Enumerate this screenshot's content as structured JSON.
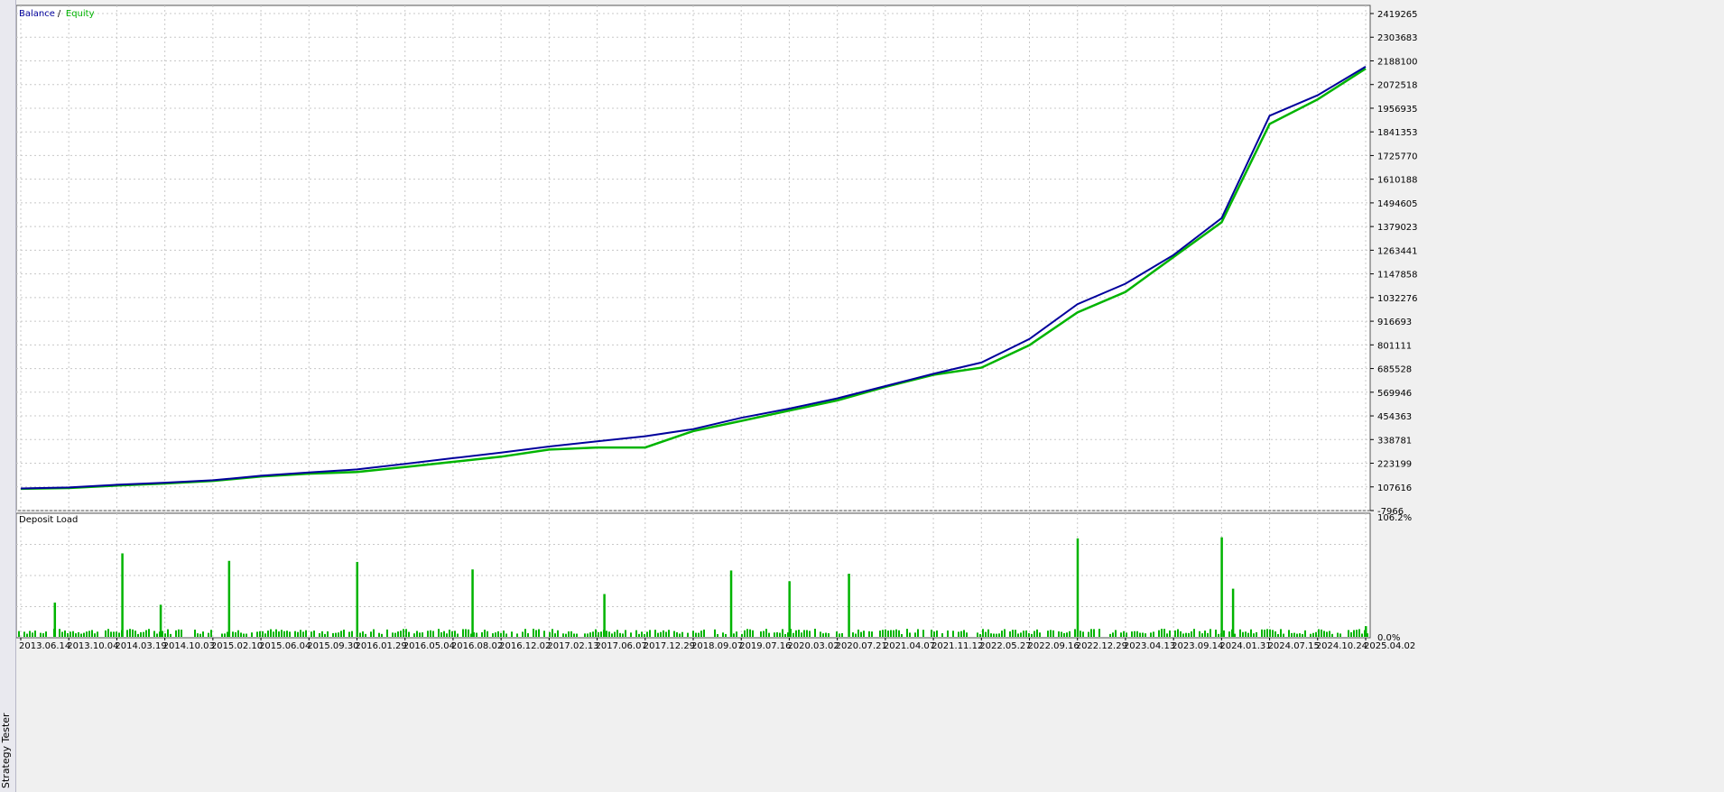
{
  "window": {
    "side_label": "Strategy Tester"
  },
  "colors": {
    "balance": "#00009c",
    "equity": "#00b400",
    "deposit_load": "#00b400",
    "grid": "#c8c8c8",
    "background": "#ffffff"
  },
  "chart_data": [
    {
      "type": "line",
      "legend": [
        "Balance",
        "Equity"
      ],
      "legend_separator": "/",
      "legend_placement": "top-left",
      "grid": true,
      "ylim": [
        -7966,
        2419265
      ],
      "y_ticks": [
        "2419265",
        "2303683",
        "2188100",
        "2072518",
        "1956935",
        "1841353",
        "1725770",
        "1610188",
        "1494605",
        "1379023",
        "1263441",
        "1147858",
        "1032276",
        "916693",
        "801111",
        "685528",
        "569946",
        "454363",
        "338781",
        "223199",
        "107616",
        "-7966"
      ],
      "x_ticks": [
        "2013.06.14",
        "2013.10.04",
        "2014.03.19",
        "2014.10.03",
        "2015.02.10",
        "2015.06.04",
        "2015.09.30",
        "2016.01.29",
        "2016.05.04",
        "2016.08.02",
        "2016.12.02",
        "2017.02.13",
        "2017.06.07",
        "2017.12.29",
        "2018.09.07",
        "2019.07.16",
        "2020.03.02",
        "2020.07.21",
        "2021.04.07",
        "2021.11.12",
        "2022.05.27",
        "2022.09.16",
        "2022.12.29",
        "2023.04.13",
        "2023.09.14",
        "2024.01.31",
        "2024.07.15",
        "2024.10.24",
        "2025.04.02"
      ],
      "series": [
        {
          "name": "Balance",
          "x": [
            "2013.06.14",
            "2013.10.04",
            "2014.03.19",
            "2014.10.03",
            "2015.02.10",
            "2015.06.04",
            "2015.09.30",
            "2016.01.29",
            "2016.05.04",
            "2016.08.02",
            "2016.12.02",
            "2017.02.13",
            "2017.06.07",
            "2017.12.29",
            "2018.09.07",
            "2019.07.16",
            "2020.03.02",
            "2020.07.21",
            "2021.04.07",
            "2021.11.12",
            "2022.05.27",
            "2022.09.16",
            "2022.12.29",
            "2023.04.13",
            "2023.09.14",
            "2024.01.31",
            "2024.07.15",
            "2024.10.24",
            "2025.04.02"
          ],
          "values": [
            100000,
            105000,
            118000,
            128000,
            140000,
            162000,
            178000,
            193000,
            220000,
            248000,
            275000,
            305000,
            330000,
            355000,
            390000,
            445000,
            490000,
            540000,
            600000,
            660000,
            715000,
            830000,
            1000000,
            1100000,
            1240000,
            1420000,
            1920000,
            2020000,
            2160000
          ]
        },
        {
          "name": "Equity",
          "x": [
            "2013.06.14",
            "2013.10.04",
            "2014.03.19",
            "2014.10.03",
            "2015.02.10",
            "2015.06.04",
            "2015.09.30",
            "2016.01.29",
            "2016.05.04",
            "2016.08.02",
            "2016.12.02",
            "2017.02.13",
            "2017.06.07",
            "2017.12.29",
            "2018.09.07",
            "2019.07.16",
            "2020.03.02",
            "2020.07.21",
            "2021.04.07",
            "2021.11.12",
            "2022.05.27",
            "2022.09.16",
            "2022.12.29",
            "2023.04.13",
            "2023.09.14",
            "2024.01.31",
            "2024.07.15",
            "2024.10.24",
            "2025.04.02"
          ],
          "values": [
            98000,
            102000,
            114000,
            124000,
            137000,
            158000,
            172000,
            180000,
            205000,
            230000,
            255000,
            290000,
            300000,
            300000,
            380000,
            430000,
            480000,
            530000,
            596000,
            655000,
            690000,
            800000,
            960000,
            1060000,
            1230000,
            1400000,
            1880000,
            2000000,
            2150000
          ]
        }
      ]
    },
    {
      "type": "bar",
      "title": "Deposit Load",
      "ylim": [
        0,
        106.2
      ],
      "y_ticks": [
        "106.2%",
        "0.0%"
      ],
      "peaks": [
        {
          "x": "2013.09.01",
          "value": 32
        },
        {
          "x": "2014.04.10",
          "value": 78
        },
        {
          "x": "2014.09.15",
          "value": 30
        },
        {
          "x": "2015.03.20",
          "value": 71
        },
        {
          "x": "2016.01.29",
          "value": 70
        },
        {
          "x": "2016.09.20",
          "value": 63
        },
        {
          "x": "2017.07.07",
          "value": 40
        },
        {
          "x": "2019.05.10",
          "value": 62
        },
        {
          "x": "2020.03.02",
          "value": 52
        },
        {
          "x": "2020.09.21",
          "value": 59
        },
        {
          "x": "2022.12.29",
          "value": 92
        },
        {
          "x": "2024.01.31",
          "value": 93
        },
        {
          "x": "2024.03.10",
          "value": 45
        },
        {
          "x": "2025.04.02",
          "value": 10
        }
      ]
    }
  ]
}
